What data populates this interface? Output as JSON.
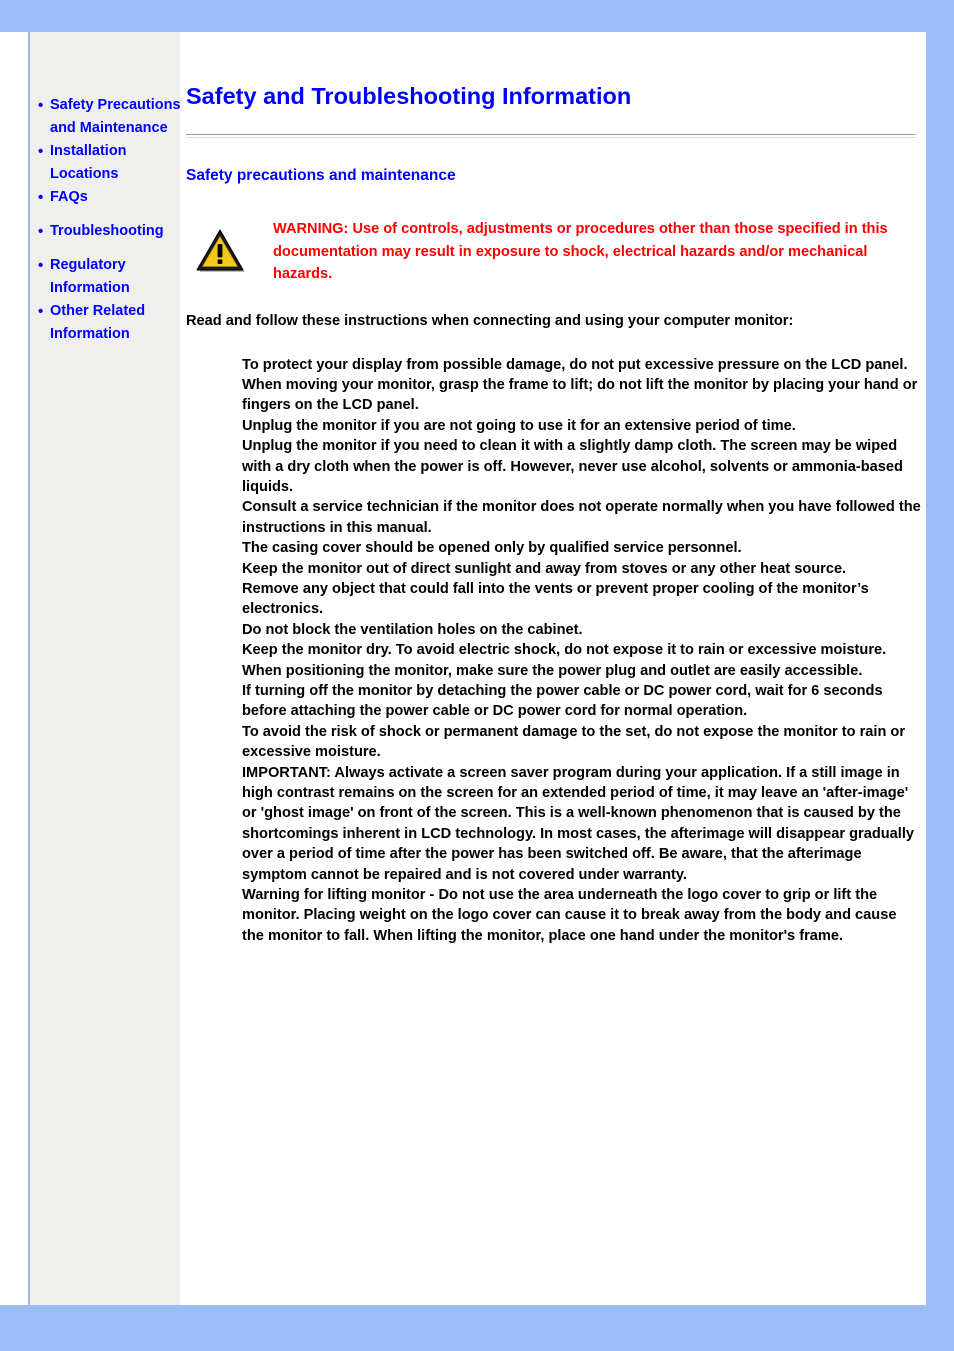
{
  "theme": {
    "outer_background": "#9bbcf7",
    "page_background": "#ffffff",
    "sidebar_background": "#efefee",
    "link_color": "#0000ff",
    "heading_color": "#0000ff",
    "warning_color": "#ff0000",
    "body_text_color": "#000000"
  },
  "sidebar": {
    "bullet": "•",
    "items": [
      {
        "label": "Safety Precautions and Maintenance",
        "nowrap": false
      },
      {
        "label": "Installation Locations",
        "nowrap": false
      },
      {
        "label": "FAQs",
        "nowrap": false
      },
      {
        "label": "Troubleshooting",
        "nowrap": true
      },
      {
        "label": "Regulatory Information",
        "nowrap": false
      },
      {
        "label": "Other Related Information",
        "nowrap": false
      }
    ]
  },
  "content": {
    "title": "Safety and Troubleshooting Information",
    "section_heading": "Safety precautions and maintenance",
    "warning_icon_name": "warning-triangle-icon",
    "warning_text": "WARNING: Use of controls, adjustments or procedures other than those specified in this documentation may result in exposure to shock, electrical hazards and/or mechanical hazards.",
    "intro": "Read and follow these instructions when connecting and using your computer monitor:",
    "instructions": [
      "To protect your display from possible damage, do not put excessive pressure on the LCD panel. When moving your monitor, grasp the frame to lift; do not lift the monitor by placing your hand or fingers on the LCD panel.",
      "Unplug the monitor if you are not going to use it for an extensive period of time.",
      "Unplug the monitor if you need to clean it with a slightly damp cloth. The screen may be wiped with a dry cloth when the power is off. However, never use alcohol, solvents or ammonia-based liquids.",
      "Consult a service technician if the monitor does not operate normally when you have followed the instructions in this manual.",
      "The casing cover should be opened only by qualified service personnel.",
      "Keep the monitor out of direct sunlight and away from stoves or any other heat source.",
      "Remove any object that could fall into the vents or prevent proper cooling of the monitor’s electronics.",
      "Do not block the ventilation holes on the cabinet.",
      "Keep the monitor dry. To avoid electric shock, do not expose it to rain or excessive moisture.",
      "When positioning the monitor, make sure the power plug and outlet are easily accessible.",
      "If turning off the monitor by detaching the power cable or DC power cord, wait for 6 seconds before attaching the power cable or DC power cord for normal operation.",
      "To avoid the risk of shock or permanent damage to the set, do not expose the monitor to rain or excessive moisture.",
      "IMPORTANT: Always activate a screen saver program during your application. If a still image in high contrast remains on the screen for an extended period of time, it may leave an 'after-image' or 'ghost image' on front of the screen. This is a well-known phenomenon that is caused by the shortcomings inherent in LCD technology. In most cases, the afterimage will disappear gradually over a period of time after the power has been switched off. Be aware, that the afterimage symptom cannot be repaired and is not covered under warranty.",
      "Warning for lifting monitor - Do not use the area underneath the logo cover to grip or lift the monitor. Placing weight on the logo cover can cause it to break away from the body and cause the monitor to fall. When lifting the monitor, place one hand under the monitor's frame."
    ]
  }
}
